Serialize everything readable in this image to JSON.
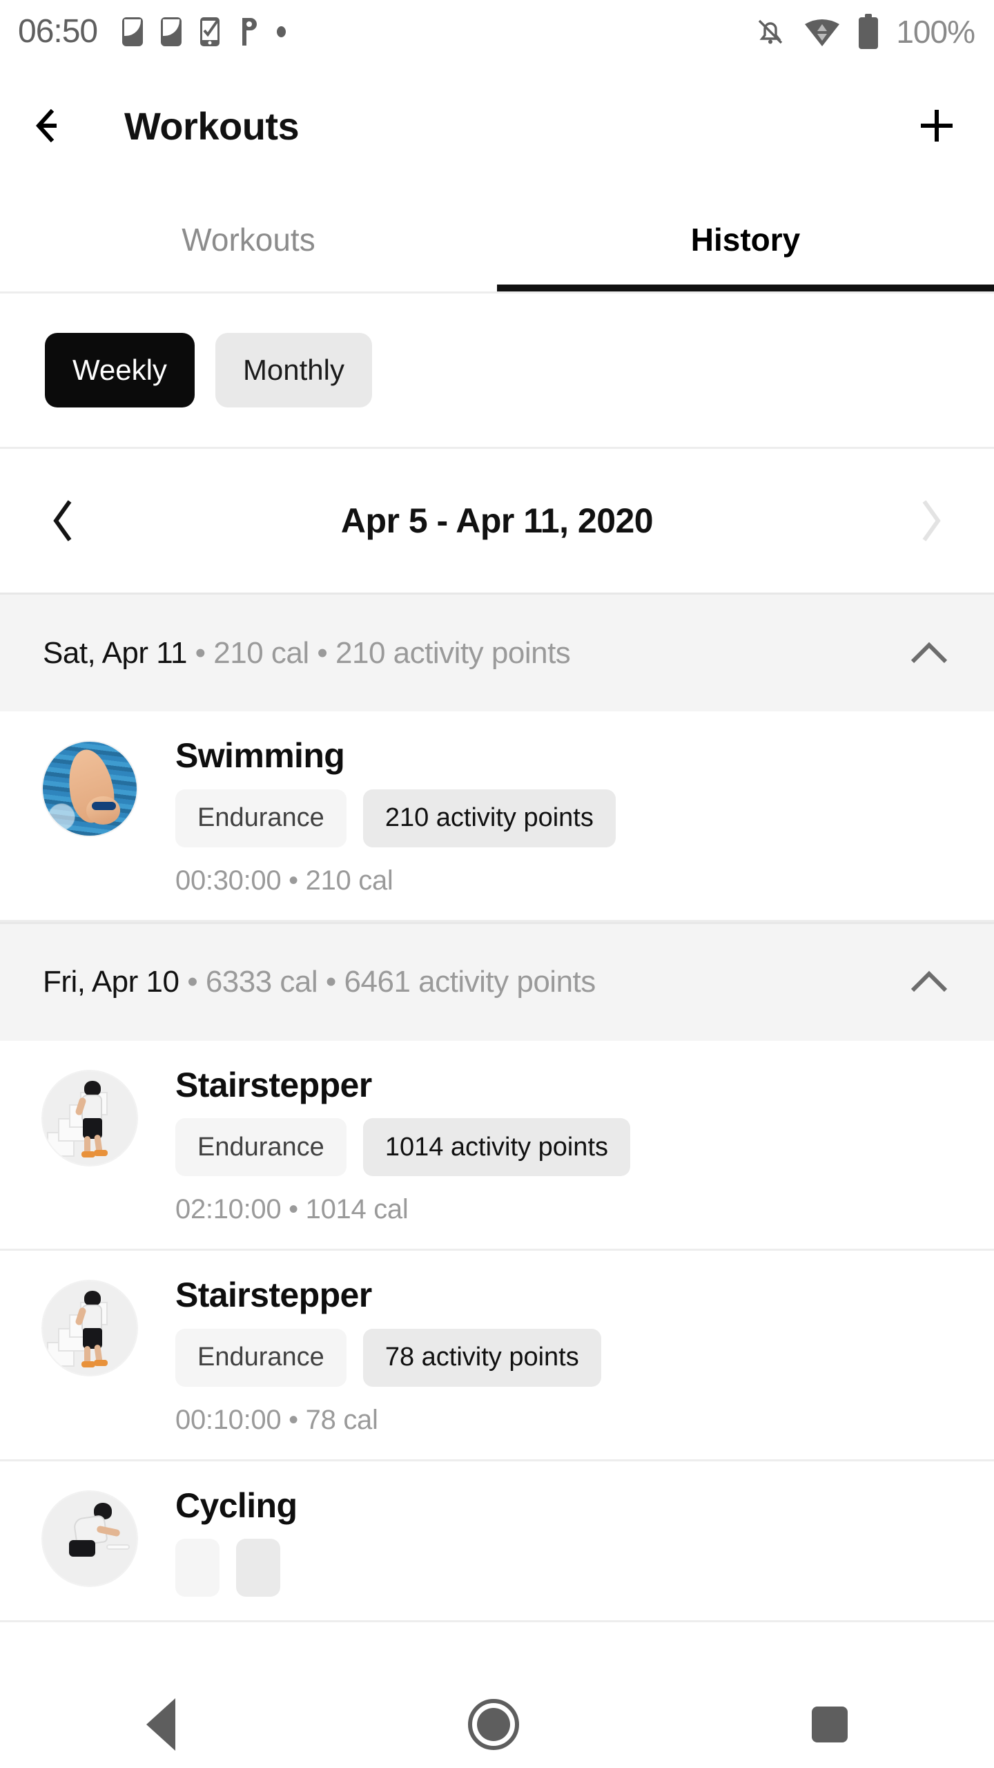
{
  "status_bar": {
    "time": "06:50",
    "battery_percent": "100%",
    "left_icons": [
      "phone-icon",
      "phone-icon",
      "phone-check-icon",
      "p-parking-icon",
      "dot-icon"
    ],
    "right_icons": [
      "notifications-off-icon",
      "wifi-icon",
      "battery-full-icon"
    ]
  },
  "app_bar": {
    "back_icon": "arrow-left-icon",
    "title": "Workouts",
    "add_icon": "plus-icon"
  },
  "tabs": [
    {
      "label": "Workouts",
      "active": false
    },
    {
      "label": "History",
      "active": true
    }
  ],
  "period_toggle": {
    "options": [
      {
        "label": "Weekly",
        "selected": true
      },
      {
        "label": "Monthly",
        "selected": false
      }
    ]
  },
  "date_nav": {
    "prev_icon": "chevron-left-icon",
    "range": "Apr 5 - Apr 11, 2020",
    "next_icon": "chevron-right-icon",
    "next_disabled": true
  },
  "days": [
    {
      "date": "Sat, Apr 11",
      "calories": "210 cal",
      "points": "210 activity points",
      "separator": " • ",
      "collapse_icon": "chevron-up-icon",
      "workouts": [
        {
          "name": "Swimming",
          "avatar": "swimming-photo",
          "type_chip": "Endurance",
          "points_chip": "210 activity points",
          "meta": "00:30:00 • 210 cal"
        }
      ]
    },
    {
      "date": "Fri, Apr 10",
      "calories": "6333 cal",
      "points": "6461 activity points",
      "separator": " • ",
      "collapse_icon": "chevron-up-icon",
      "workouts": [
        {
          "name": "Stairstepper",
          "avatar": "stairstepper-figure",
          "type_chip": "Endurance",
          "points_chip": "1014 activity points",
          "meta": "02:10:00 • 1014 cal"
        },
        {
          "name": "Stairstepper",
          "avatar": "stairstepper-figure",
          "type_chip": "Endurance",
          "points_chip": "78 activity points",
          "meta": "00:10:00 • 78 cal"
        },
        {
          "name": "Cycling",
          "avatar": "cycling-figure",
          "type_chip": "",
          "points_chip": "",
          "meta": ""
        }
      ]
    }
  ],
  "nav_bar": {
    "back_icon": "triangle-back-icon",
    "home_icon": "circle-home-icon",
    "recents_icon": "square-recents-icon"
  },
  "colors": {
    "accent": "#000000",
    "muted_text": "#9a9a9a",
    "day_header_bg": "#f4f4f4",
    "chip_bg": "#eaeaea"
  }
}
